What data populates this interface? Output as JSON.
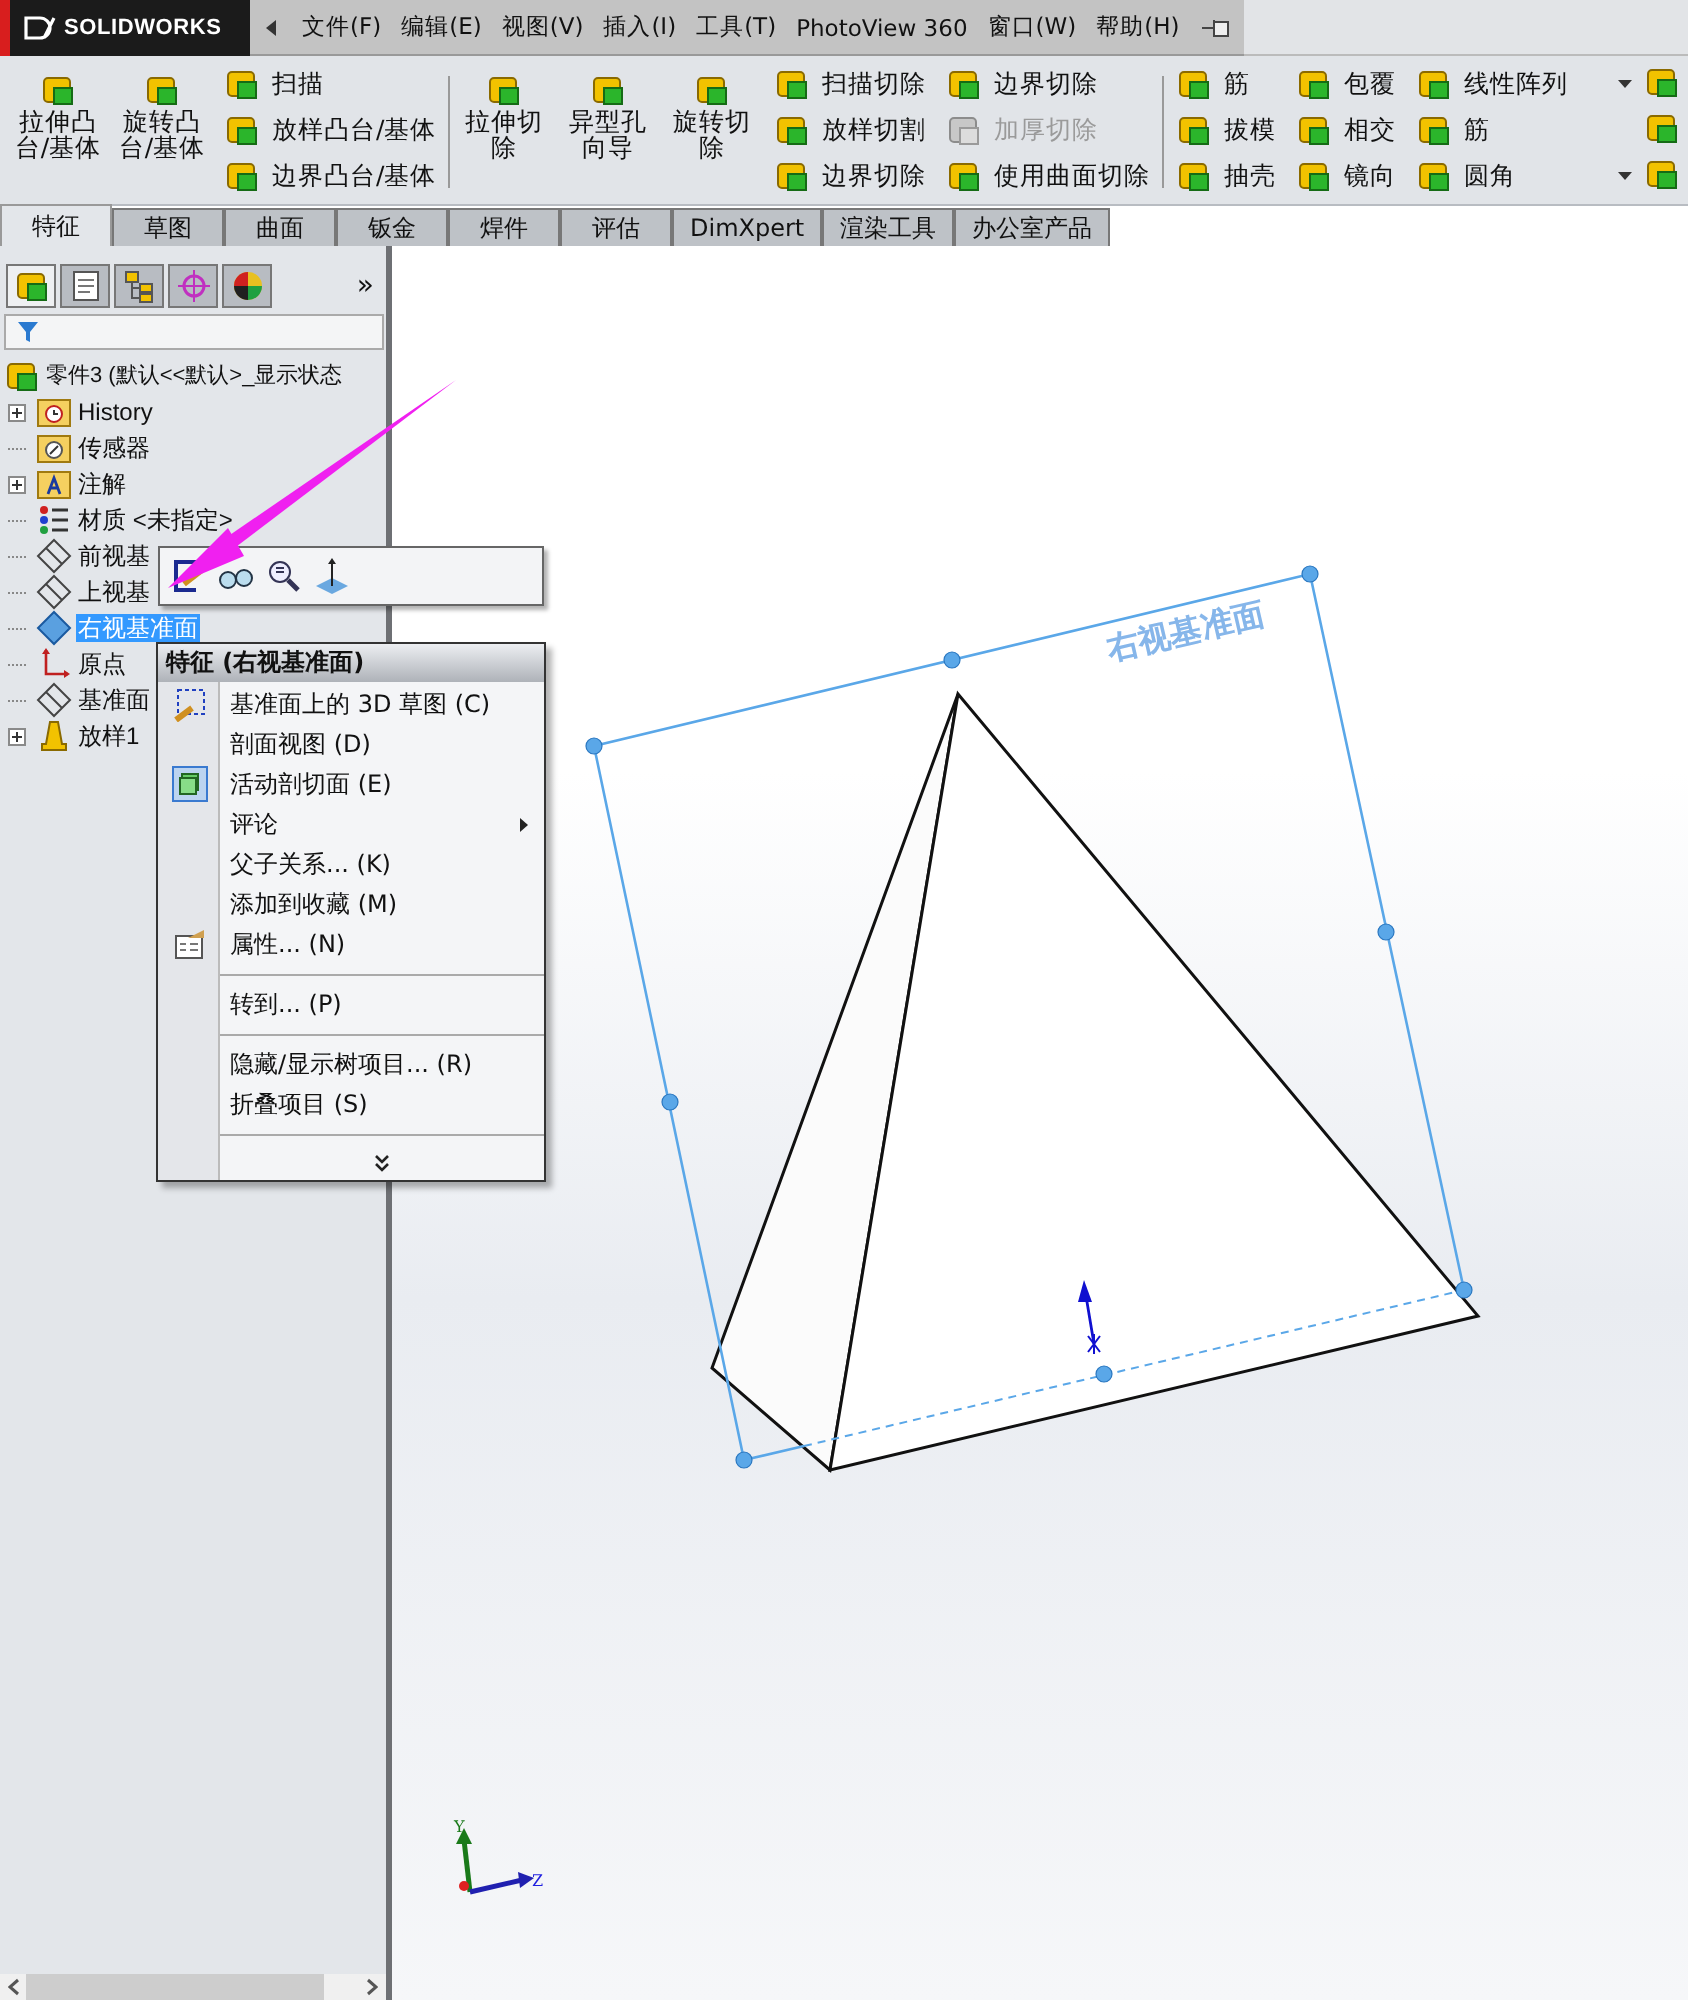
{
  "app": {
    "logo": "SOLIDWORKS"
  },
  "menu_bar": [
    {
      "label": "文件(F)"
    },
    {
      "label": "编辑(E)"
    },
    {
      "label": "视图(V)"
    },
    {
      "label": "插入(I)"
    },
    {
      "label": "工具(T)"
    },
    {
      "label": "PhotoView 360"
    },
    {
      "label": "窗口(W)"
    },
    {
      "label": "帮助(H)"
    }
  ],
  "ribbon": {
    "groups": [
      {
        "large": [
          {
            "label": "拉伸凸台/基体"
          },
          {
            "label": "旋转凸台/基体"
          }
        ],
        "columns": [
          [
            {
              "label": "扫描",
              "disabled": false,
              "dropdown": false
            },
            {
              "label": "放样凸台/基体",
              "disabled": false,
              "dropdown": false
            },
            {
              "label": "边界凸台/基体",
              "disabled": false,
              "dropdown": false
            }
          ]
        ]
      },
      {
        "large": [
          {
            "label": "拉伸切除"
          },
          {
            "label": "异型孔向导"
          },
          {
            "label": "旋转切除"
          }
        ],
        "columns": [
          [
            {
              "label": "扫描切除",
              "disabled": false,
              "dropdown": false
            },
            {
              "label": "放样切割",
              "disabled": false,
              "dropdown": false
            },
            {
              "label": "边界切除",
              "disabled": false,
              "dropdown": false
            }
          ],
          [
            {
              "label": "边界切除",
              "disabled": false,
              "dropdown": false
            },
            {
              "label": "加厚切除",
              "disabled": true,
              "dropdown": false
            },
            {
              "label": "使用曲面切除",
              "disabled": false,
              "dropdown": false
            }
          ]
        ]
      },
      {
        "columns": [
          [
            {
              "label": "筋",
              "disabled": false,
              "dropdown": false
            },
            {
              "label": "拔模",
              "disabled": false,
              "dropdown": false
            },
            {
              "label": "抽壳",
              "disabled": false,
              "dropdown": false
            }
          ],
          [
            {
              "label": "包覆",
              "disabled": false,
              "dropdown": false
            },
            {
              "label": "相交",
              "disabled": false,
              "dropdown": false
            },
            {
              "label": "镜向",
              "disabled": false,
              "dropdown": false
            }
          ],
          [
            {
              "label": "线性阵列",
              "disabled": false,
              "dropdown": true
            },
            {
              "label": "筋",
              "disabled": false,
              "dropdown": false
            },
            {
              "label": "圆角",
              "disabled": false,
              "dropdown": true
            }
          ]
        ]
      }
    ]
  },
  "tabs": [
    {
      "label": "特征",
      "selected": true
    },
    {
      "label": "草图",
      "selected": false
    },
    {
      "label": "曲面",
      "selected": false
    },
    {
      "label": "钣金",
      "selected": false
    },
    {
      "label": "焊件",
      "selected": false
    },
    {
      "label": "评估",
      "selected": false
    },
    {
      "label": "DimXpert",
      "selected": false
    },
    {
      "label": "渲染工具",
      "selected": false
    },
    {
      "label": "办公室产品",
      "selected": false
    }
  ],
  "panel": {
    "tabs": [
      {
        "selected": true
      },
      {
        "selected": false
      },
      {
        "selected": false
      },
      {
        "selected": false
      },
      {
        "selected": false
      }
    ],
    "overflow": "»",
    "tree": {
      "label": "零件3 (默认<<默认>_显示状态",
      "kind": "part",
      "children": [
        {
          "label": "History",
          "kind": "history",
          "has_children": true,
          "selected": false
        },
        {
          "label": "传感器",
          "kind": "sensor",
          "has_children": false,
          "selected": false
        },
        {
          "label": "注解",
          "kind": "annotation",
          "has_children": true,
          "selected": false
        },
        {
          "label": "材质 <未指定>",
          "kind": "material",
          "has_children": false,
          "selected": false
        },
        {
          "label": "前视基",
          "kind": "plane",
          "has_children": false,
          "selected": false
        },
        {
          "label": "上视基",
          "kind": "plane",
          "has_children": false,
          "selected": false
        },
        {
          "label": "右视基准面",
          "kind": "plane",
          "has_children": false,
          "selected": true
        },
        {
          "label": "原点",
          "kind": "origin",
          "has_children": false,
          "selected": false
        },
        {
          "label": "基准面",
          "kind": "plane",
          "has_children": false,
          "selected": false
        },
        {
          "label": "放样1",
          "kind": "feature",
          "has_children": true,
          "selected": false
        }
      ]
    }
  },
  "context_menu": {
    "title": "特征 (右视基准面)",
    "items": [
      {
        "kind": "command",
        "label": "基准面上的 3D 草图 (C)"
      },
      {
        "kind": "command",
        "label": "剖面视图 (D)"
      },
      {
        "kind": "command",
        "label": "活动剖切面 (E)"
      },
      {
        "kind": "submenu",
        "label": "评论"
      },
      {
        "kind": "command",
        "label": "父子关系... (K)"
      },
      {
        "kind": "command",
        "label": "添加到收藏 (M)"
      },
      {
        "kind": "command",
        "label": "属性... (N)"
      },
      {
        "kind": "separator"
      },
      {
        "kind": "command",
        "label": "转到... (P)"
      },
      {
        "kind": "separator"
      },
      {
        "kind": "command",
        "label": "隐藏/显示树项目... (R)"
      },
      {
        "kind": "command",
        "label": "折叠项目 (S)"
      },
      {
        "kind": "separator"
      },
      {
        "kind": "more"
      }
    ]
  },
  "viewport": {
    "plane_label": "右视基准面",
    "axis_labels": [
      {
        "label": "Y"
      },
      {
        "label": "Z"
      }
    ]
  }
}
